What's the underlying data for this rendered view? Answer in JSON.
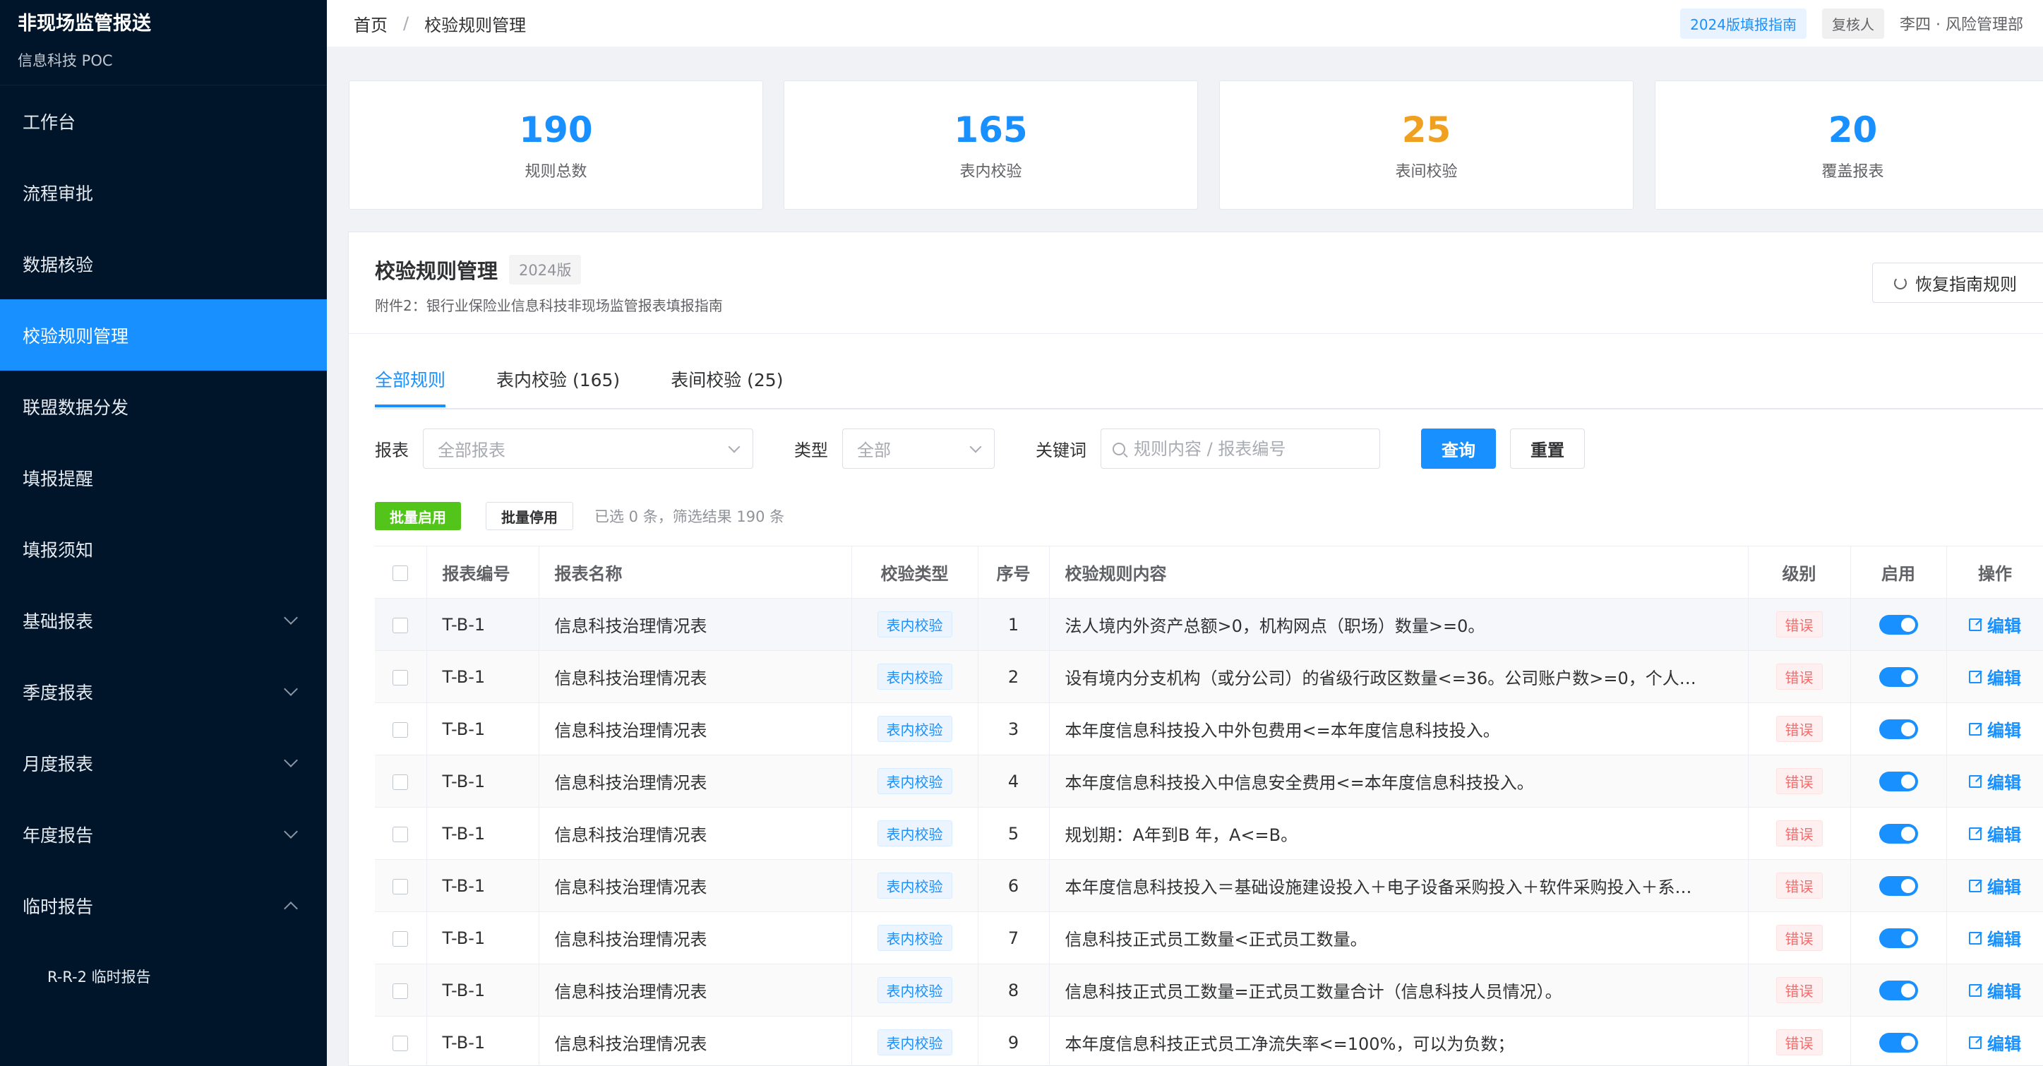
{
  "app": {
    "title": "非现场监管报送",
    "subtitle": "信息科技 POC"
  },
  "sidebar": {
    "items": [
      {
        "label": "工作台"
      },
      {
        "label": "流程审批"
      },
      {
        "label": "数据核验"
      },
      {
        "label": "校验规则管理",
        "active": true
      },
      {
        "label": "联盟数据分发"
      },
      {
        "label": "填报提醒"
      },
      {
        "label": "填报须知"
      },
      {
        "label": "基础报表",
        "expandable": true
      },
      {
        "label": "季度报表",
        "expandable": true
      },
      {
        "label": "月度报表",
        "expandable": true
      },
      {
        "label": "年度报告",
        "expandable": true
      },
      {
        "label": "临时报告",
        "expandable": true,
        "expanded": true
      }
    ],
    "sub_items": [
      {
        "label": "R-R-2 临时报告"
      }
    ]
  },
  "header": {
    "breadcrumb": [
      "首页",
      "校验规则管理"
    ],
    "breadcrumb_sep": "/",
    "guide_tag": "2024版填报指南",
    "role_tag": "复核人",
    "user": "李四 · 风险管理部"
  },
  "stats": [
    {
      "value": "190",
      "label": "规则总数",
      "color": "#1890ff"
    },
    {
      "value": "165",
      "label": "表内校验",
      "color": "#1890ff"
    },
    {
      "value": "25",
      "label": "表间校验",
      "color": "#f0a020"
    },
    {
      "value": "20",
      "label": "覆盖报表",
      "color": "#1890ff"
    }
  ],
  "panel": {
    "title": "校验规则管理",
    "version": "2024版",
    "subtitle": "附件2：银行业保险业信息科技非现场监管报表填报指南",
    "restore_label": "恢复指南规则"
  },
  "tabs": [
    {
      "label": "全部规则",
      "active": true
    },
    {
      "label": "表内校验 (165)"
    },
    {
      "label": "表间校验 (25)"
    }
  ],
  "filters": {
    "report_label": "报表",
    "report_value": "全部报表",
    "type_label": "类型",
    "type_value": "全部",
    "keyword_label": "关键词",
    "keyword_placeholder": "规则内容 / 报表编号",
    "query_label": "查询",
    "reset_label": "重置"
  },
  "batch": {
    "enable_label": "批量启用",
    "disable_label": "批量停用",
    "info": "已选 0 条，筛选结果 190 条"
  },
  "table": {
    "columns": [
      "报表编号",
      "报表名称",
      "校验类型",
      "序号",
      "校验规则内容",
      "级别",
      "启用",
      "操作"
    ],
    "edit_label": "编辑",
    "rows": [
      {
        "code": "T-B-1",
        "name": "信息科技治理情况表",
        "type": "表内校验",
        "seq": "1",
        "content": "法人境内外资产总额>0，机构网点（职场）数量>=0。",
        "level": "错误",
        "enabled": true
      },
      {
        "code": "T-B-1",
        "name": "信息科技治理情况表",
        "type": "表内校验",
        "seq": "2",
        "content": "设有境内分支机构（或分公司）的省级行政区数量<=36。公司账户数>=0，个人…",
        "level": "错误",
        "enabled": true
      },
      {
        "code": "T-B-1",
        "name": "信息科技治理情况表",
        "type": "表内校验",
        "seq": "3",
        "content": "本年度信息科技投入中外包费用<=本年度信息科技投入。",
        "level": "错误",
        "enabled": true
      },
      {
        "code": "T-B-1",
        "name": "信息科技治理情况表",
        "type": "表内校验",
        "seq": "4",
        "content": "本年度信息科技投入中信息安全费用<=本年度信息科技投入。",
        "level": "错误",
        "enabled": true
      },
      {
        "code": "T-B-1",
        "name": "信息科技治理情况表",
        "type": "表内校验",
        "seq": "5",
        "content": "规划期：A年到B 年，A<=B。",
        "level": "错误",
        "enabled": true
      },
      {
        "code": "T-B-1",
        "name": "信息科技治理情况表",
        "type": "表内校验",
        "seq": "6",
        "content": "本年度信息科技投入＝基础设施建设投入＋电子设备采购投入＋软件采购投入＋系…",
        "level": "错误",
        "enabled": true
      },
      {
        "code": "T-B-1",
        "name": "信息科技治理情况表",
        "type": "表内校验",
        "seq": "7",
        "content": "信息科技正式员工数量<正式员工数量。",
        "level": "错误",
        "enabled": true
      },
      {
        "code": "T-B-1",
        "name": "信息科技治理情况表",
        "type": "表内校验",
        "seq": "8",
        "content": "信息科技正式员工数量=正式员工数量合计（信息科技人员情况）。",
        "level": "错误",
        "enabled": true
      },
      {
        "code": "T-B-1",
        "name": "信息科技治理情况表",
        "type": "表内校验",
        "seq": "9",
        "content": "本年度信息科技正式员工净流失率<=100%，可以为负数；",
        "level": "错误",
        "enabled": true
      }
    ]
  }
}
